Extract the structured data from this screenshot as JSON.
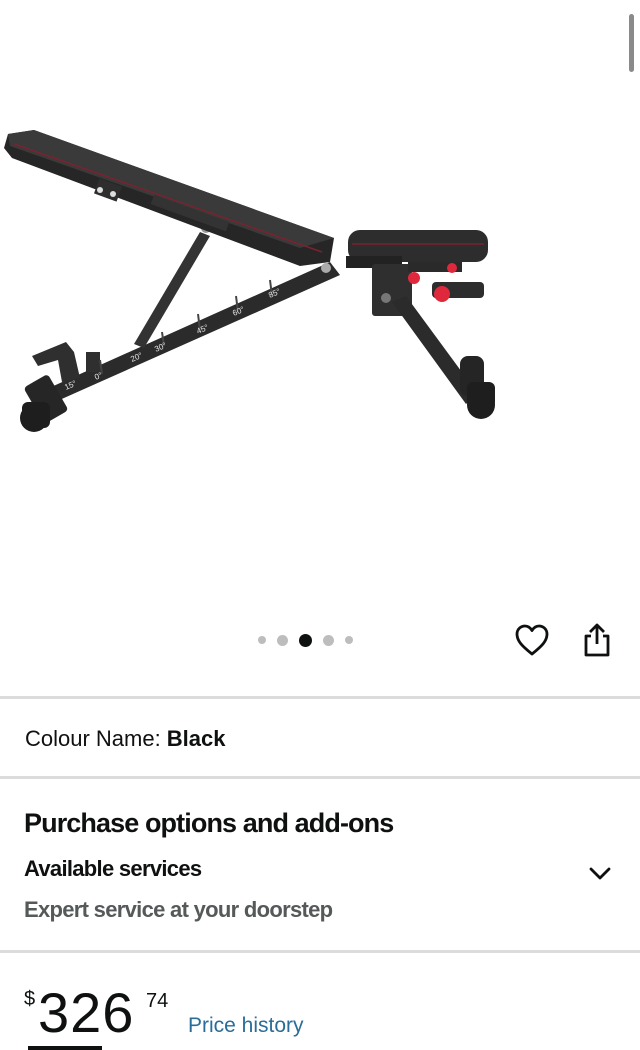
{
  "gallery": {
    "image_alt": "Adjustable weight bench, black",
    "angle_labels": [
      "15°",
      "0°",
      "20°",
      "30°",
      "45°",
      "60°",
      "85°"
    ],
    "dot_count": 5,
    "active_dot": 2
  },
  "actions": {
    "wishlist_icon": "heart-icon",
    "share_icon": "share-icon"
  },
  "variation": {
    "label": "Colour Name:",
    "value": "Black"
  },
  "purchase_options": {
    "title": "Purchase options and add-ons",
    "services_label": "Available services",
    "services_detail": "Expert service at your doorstep",
    "expand_icon": "chevron-down-icon"
  },
  "price": {
    "symbol": "$",
    "whole": "326",
    "fraction": "74",
    "history_link": "Price history"
  },
  "colors": {
    "text": "#0f1111",
    "muted": "#565959",
    "link": "#2a6d99",
    "divider": "#dcdcdc",
    "accent_red": "#e0283c"
  }
}
